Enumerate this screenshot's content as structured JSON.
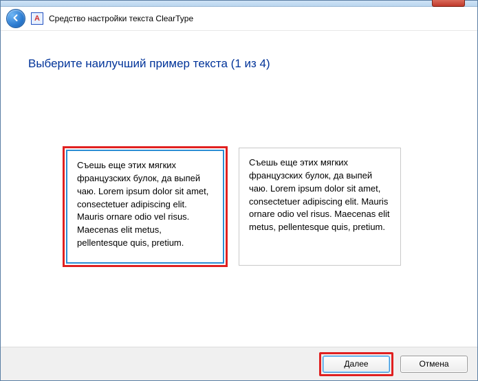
{
  "header": {
    "title": "Средство настройки текста ClearType"
  },
  "main": {
    "heading": "Выберите наилучший пример текста (1 из 4)",
    "sample_text": "Съешь еще этих мягких французских булок, да выпей чаю. Lorem ipsum dolor sit amet, consectetuer adipiscing elit. Mauris ornare odio vel risus. Maecenas elit metus, pellentesque quis, pretium."
  },
  "buttons": {
    "next": "Далее",
    "cancel": "Отмена"
  }
}
